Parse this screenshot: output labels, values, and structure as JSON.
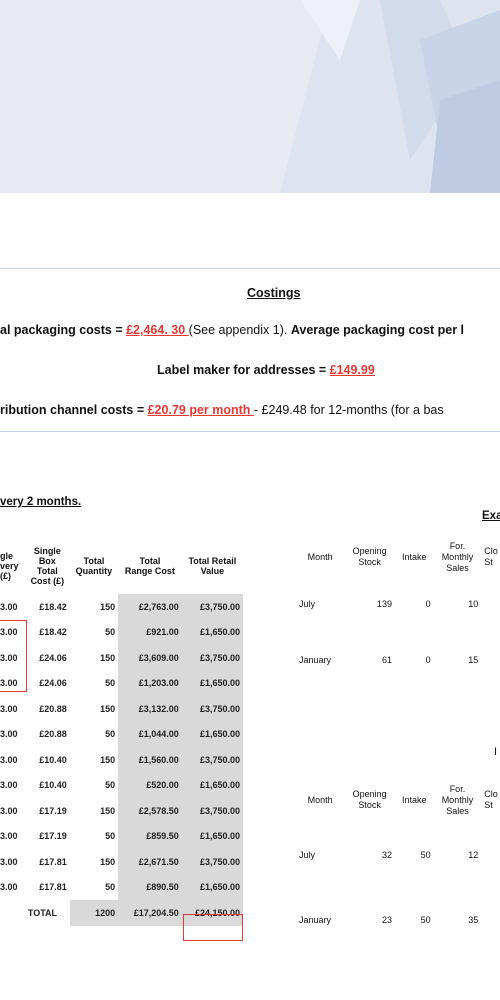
{
  "costings": {
    "title": "Costings",
    "line1_prefix": "al packaging costs = ",
    "line1_value": "£2,464. 30 ",
    "line1_note": "(See appendix 1). ",
    "line1_tail": "Average packaging cost per l",
    "line2_prefix": "Label maker for addresses = ",
    "line2_value": "£149.99",
    "line3_prefix": "ribution channel costs = ",
    "line3_value": "£20.79 per month ",
    "line3_tail": "- £249.48 for 12-months (for a bas"
  },
  "left_heading": "very 2 months.",
  "right_heading": "Exa",
  "left_table": {
    "headers": [
      "gle\nvery\n(£)",
      "Single\nBox\nTotal\nCost (£)",
      "Total\nQuantity",
      "Total\nRange Cost",
      "Total Retail\nValue"
    ],
    "rows": [
      [
        "3.00",
        "£18.42",
        "150",
        "£2,763.00",
        "£3,750.00"
      ],
      [
        "3.00",
        "£18.42",
        "50",
        "£921.00",
        "£1,650.00"
      ],
      [
        "3.00",
        "£24.06",
        "150",
        "£3,609.00",
        "£3,750.00"
      ],
      [
        "3.00",
        "£24.06",
        "50",
        "£1,203.00",
        "£1,650.00"
      ],
      [
        "3.00",
        "£20.88",
        "150",
        "£3,132.00",
        "£3,750.00"
      ],
      [
        "3.00",
        "£20.88",
        "50",
        "£1,044.00",
        "£1,650.00"
      ],
      [
        "3.00",
        "£10.40",
        "150",
        "£1,560.00",
        "£3,750.00"
      ],
      [
        "3.00",
        "£10.40",
        "50",
        "£520.00",
        "£1,650.00"
      ],
      [
        "3.00",
        "£17.19",
        "150",
        "£2,578.50",
        "£3,750.00"
      ],
      [
        "3.00",
        "£17.19",
        "50",
        "£859.50",
        "£1,650.00"
      ],
      [
        "3.00",
        "£17.81",
        "150",
        "£2,671.50",
        "£3,750.00"
      ],
      [
        "3.00",
        "£17.81",
        "50",
        "£890.50",
        "£1,650.00"
      ]
    ],
    "total": [
      "",
      "TOTAL",
      "1200",
      "£17,204.50",
      "£24,150.00"
    ]
  },
  "right_table_1": {
    "headers": [
      "Month",
      "Opening\nStock",
      "Intake",
      "For.\nMonthly\nSales",
      "Clo\nSt"
    ],
    "rows": [
      [
        "July",
        "139",
        "0",
        "10"
      ],
      [
        "January",
        "61",
        "0",
        "15"
      ]
    ]
  },
  "right_table_2": {
    "side_label": "I",
    "headers": [
      "Month",
      "Opening\nStock",
      "Intake",
      "For.\nMonthly\nSales",
      "Clo\nSt"
    ],
    "rows": [
      [
        "July",
        "32",
        "50",
        "12"
      ],
      [
        "January",
        "23",
        "50",
        "35"
      ]
    ]
  }
}
